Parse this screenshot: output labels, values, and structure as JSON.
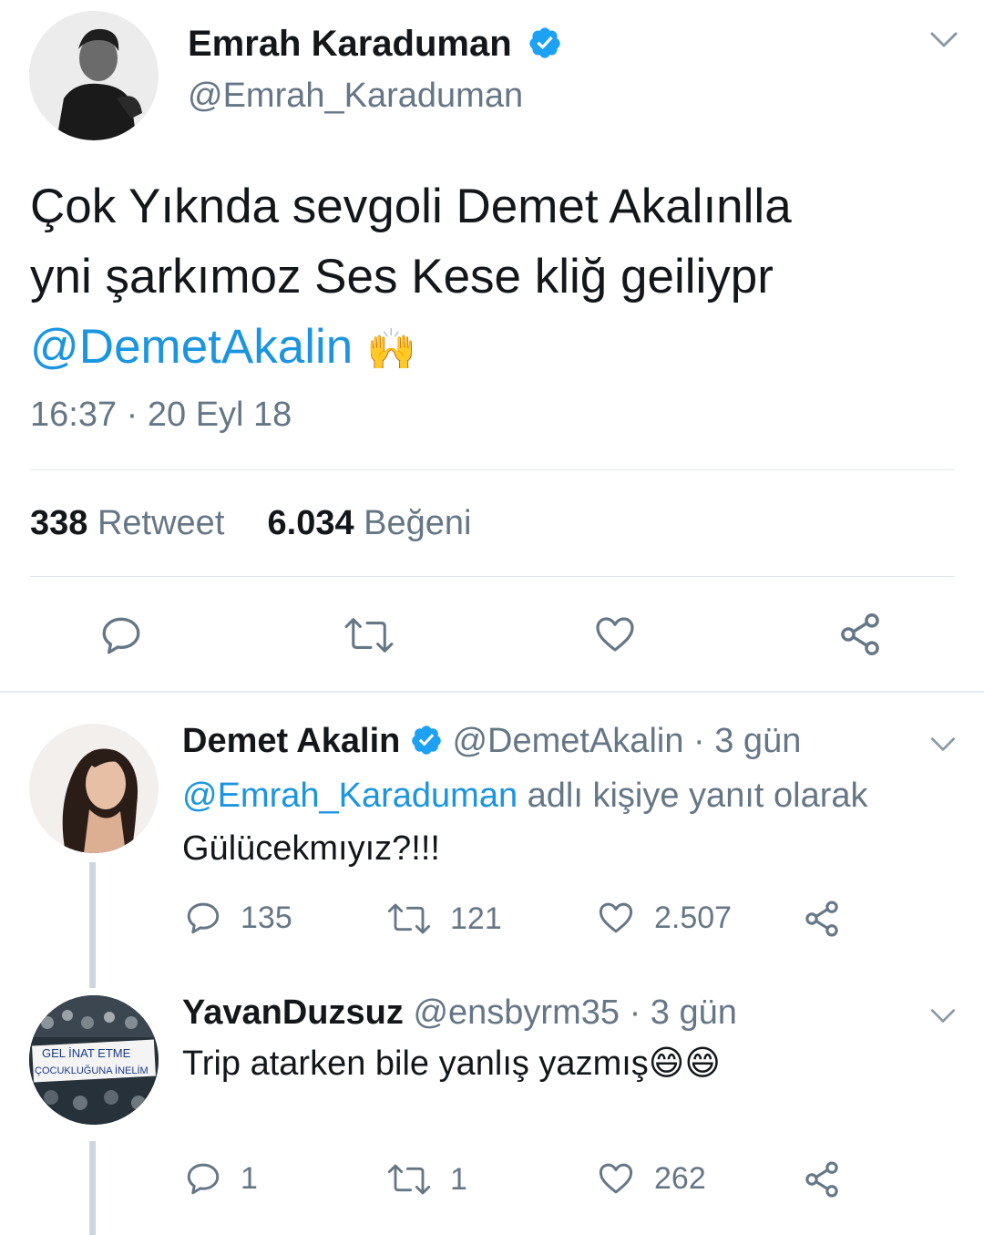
{
  "main": {
    "author_name": "Emrah Karaduman",
    "author_handle": "@Emrah_Karaduman",
    "text_line1": "Çok Yıknda sevgoli Demet Akalınlla",
    "text_line2": "yni şarkımoz Ses Kese kliğ geiliypr",
    "mention": "@DemetAkalin",
    "emoji": "🙌",
    "timestamp": "16:37 · 20 Eyl 18",
    "retweet_count": "338",
    "retweet_label": "Retweet",
    "like_count": "6.034",
    "like_label": "Beğeni"
  },
  "replies": [
    {
      "name": "Demet Akalin",
      "handle": "@DemetAkalin",
      "time": "· 3 gün",
      "reply_to_handle": "@Emrah_Karaduman",
      "reply_to_suffix": "adlı kişiye yanıt olarak",
      "text": "Gülücekmıyız?!!!",
      "reply_count": "135",
      "retweet_count": "121",
      "like_count": "2.507"
    },
    {
      "name": "YavanDuzsuz",
      "handle": "@ensbyrm35",
      "time": "· 3 gün",
      "text": "Trip atarken bile yanlış yazmış",
      "emoji": "😄😄",
      "reply_count": "1",
      "retweet_count": "1",
      "like_count": "262",
      "avatar_banner_line1": "GEL İNAT ETME",
      "avatar_banner_line2": "ÇOCUKLUĞUNA İNELİM"
    }
  ],
  "colors": {
    "text": "#14171a",
    "secondary": "#657786",
    "link": "#1b95e0",
    "verified": "#1da1f2",
    "divider": "#e1e8ed"
  },
  "icons": [
    "verified-badge-icon",
    "chevron-down-icon",
    "reply-icon",
    "retweet-icon",
    "like-icon",
    "share-icon"
  ]
}
